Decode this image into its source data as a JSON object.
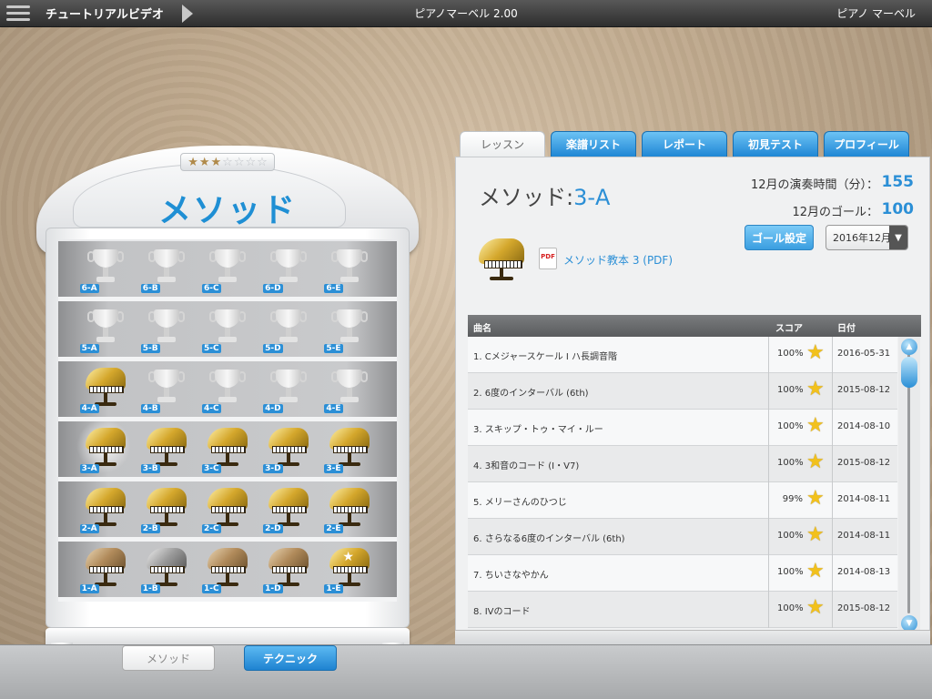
{
  "topbar": {
    "video_label": "チュートリアルビデオ",
    "app_title": "ピアノマーベル 2.00",
    "brand": "ピアノ マーベル"
  },
  "cabinet": {
    "title": "メソッド",
    "stars_filled": 3,
    "stars_total": 7,
    "shelves": [
      [
        {
          "label": "6-A",
          "type": "trophy"
        },
        {
          "label": "6-B",
          "type": "trophy"
        },
        {
          "label": "6-C",
          "type": "trophy"
        },
        {
          "label": "6-D",
          "type": "trophy"
        },
        {
          "label": "6-E",
          "type": "trophy"
        }
      ],
      [
        {
          "label": "5-A",
          "type": "trophy"
        },
        {
          "label": "5-B",
          "type": "trophy"
        },
        {
          "label": "5-C",
          "type": "trophy"
        },
        {
          "label": "5-D",
          "type": "trophy"
        },
        {
          "label": "5-E",
          "type": "trophy"
        }
      ],
      [
        {
          "label": "4-A",
          "type": "gold"
        },
        {
          "label": "4-B",
          "type": "trophy"
        },
        {
          "label": "4-C",
          "type": "trophy"
        },
        {
          "label": "4-D",
          "type": "trophy"
        },
        {
          "label": "4-E",
          "type": "trophy"
        }
      ],
      [
        {
          "label": "3-A",
          "type": "gold",
          "selected": true
        },
        {
          "label": "3-B",
          "type": "gold"
        },
        {
          "label": "3-C",
          "type": "gold"
        },
        {
          "label": "3-D",
          "type": "gold"
        },
        {
          "label": "3-E",
          "type": "gold"
        }
      ],
      [
        {
          "label": "2-A",
          "type": "gold"
        },
        {
          "label": "2-B",
          "type": "gold"
        },
        {
          "label": "2-C",
          "type": "gold"
        },
        {
          "label": "2-D",
          "type": "gold"
        },
        {
          "label": "2-E",
          "type": "gold"
        }
      ],
      [
        {
          "label": "1-A",
          "type": "bronze"
        },
        {
          "label": "1-B",
          "type": "silver"
        },
        {
          "label": "1-C",
          "type": "bronze"
        },
        {
          "label": "1-D",
          "type": "bronze"
        },
        {
          "label": "1-E",
          "type": "star"
        }
      ]
    ]
  },
  "bottom": {
    "method_label": "メソッド",
    "technique_label": "テクニック"
  },
  "tabs": [
    {
      "label": "レッスン",
      "active": true
    },
    {
      "label": "楽譜リスト",
      "active": false
    },
    {
      "label": "レポート",
      "active": false
    },
    {
      "label": "初見テスト",
      "active": false
    },
    {
      "label": "プロフィール",
      "active": false
    }
  ],
  "lesson": {
    "title_prefix": "メソッド:",
    "title_code": "3-A",
    "play_time_label": "12月の演奏時間（分）：",
    "play_time_value": "155",
    "goal_label": "12月のゴール：",
    "goal_value": "100",
    "goal_button": "ゴール設定",
    "month_value": "2016年12月",
    "pdf_link": "メソッド教本 3 (PDF)"
  },
  "table": {
    "headers": {
      "name": "曲名",
      "score": "スコア",
      "date": "日付"
    },
    "rows": [
      {
        "name": "1. Cメジャースケール I ハ長調音階",
        "score": "100%",
        "date": "2016-05-31"
      },
      {
        "name": "2. 6度のインターバル (6th)",
        "score": "100%",
        "date": "2015-08-12"
      },
      {
        "name": "3. スキップ・トゥ・マイ・ルー",
        "score": "100%",
        "date": "2014-08-10"
      },
      {
        "name": "4. 3和音のコード (I・V7)",
        "score": "100%",
        "date": "2015-08-12"
      },
      {
        "name": "5. メリーさんのひつじ",
        "score": "99%",
        "date": "2014-08-11"
      },
      {
        "name": "6. さらなる6度のインターバル (6th)",
        "score": "100%",
        "date": "2014-08-11"
      },
      {
        "name": "7. ちいさなやかん",
        "score": "100%",
        "date": "2014-08-13"
      },
      {
        "name": "8. IVのコード",
        "score": "100%",
        "date": "2015-08-12"
      }
    ]
  },
  "icons": {
    "menu": "hamburger-icon",
    "play": "play-arrow-icon",
    "pdf": "pdf-icon",
    "star": "star-icon"
  },
  "colors": {
    "accent": "#2b8fd6",
    "star": "#f2c11c",
    "topbar": "#3a3a3a"
  }
}
